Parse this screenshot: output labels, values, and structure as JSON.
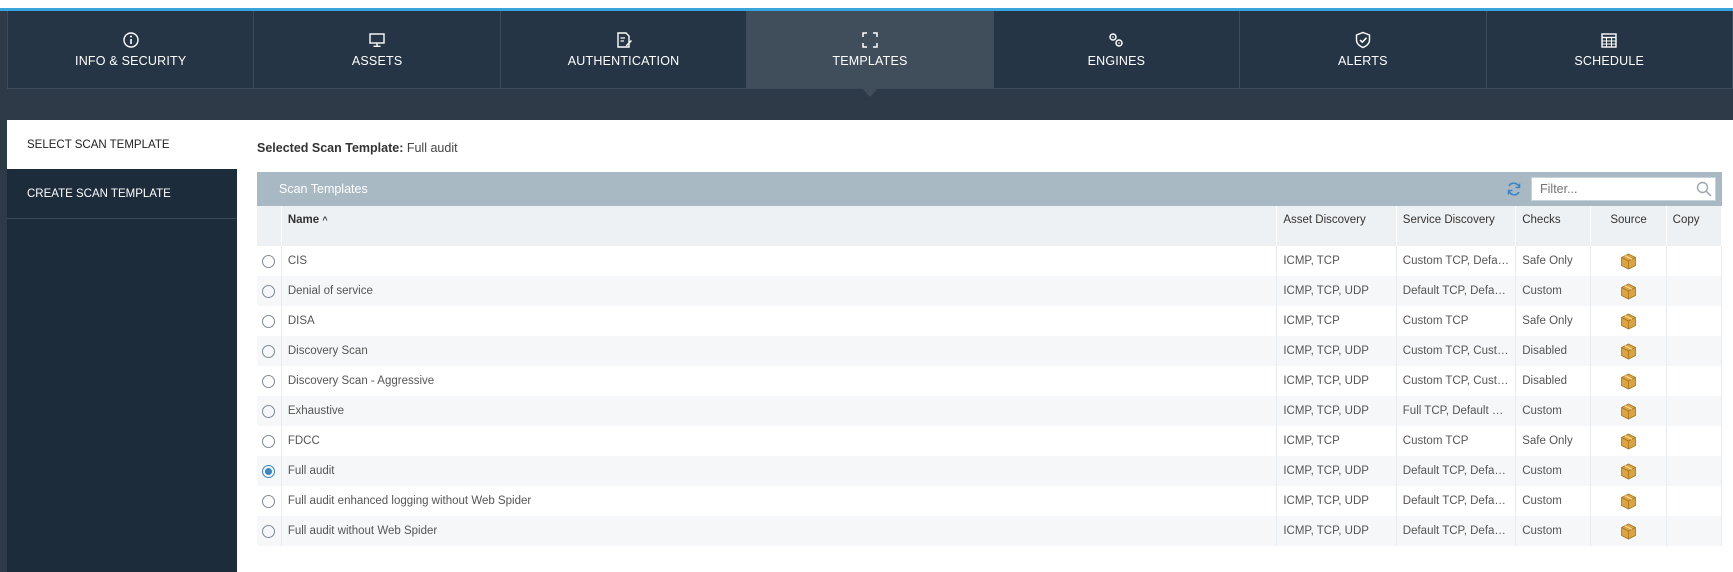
{
  "tabs": [
    {
      "label": "INFO & SECURITY",
      "icon": "info-icon"
    },
    {
      "label": "ASSETS",
      "icon": "monitor-icon"
    },
    {
      "label": "AUTHENTICATION",
      "icon": "edit-document-icon"
    },
    {
      "label": "TEMPLATES",
      "icon": "frame-icon",
      "active": true
    },
    {
      "label": "ENGINES",
      "icon": "gears-icon"
    },
    {
      "label": "ALERTS",
      "icon": "shield-check-icon"
    },
    {
      "label": "SCHEDULE",
      "icon": "calendar-icon"
    }
  ],
  "sidebar": {
    "items": [
      {
        "label": "SELECT SCAN TEMPLATE",
        "active": true
      },
      {
        "label": "CREATE SCAN TEMPLATE",
        "active": false
      }
    ]
  },
  "main": {
    "selected_prefix": "Selected Scan Template:",
    "selected_value": "Full audit",
    "panel_title": "Scan Templates",
    "filter_placeholder": "Filter..."
  },
  "table": {
    "columns": [
      "Name",
      "Asset Discovery",
      "Service Discovery",
      "Checks",
      "Source",
      "Copy"
    ],
    "sort_indicator": "^",
    "rows": [
      {
        "name": "CIS",
        "asset": "ICMP, TCP",
        "service": "Custom TCP, Default UDP",
        "checks": "Safe Only",
        "selected": false
      },
      {
        "name": "Denial of service",
        "asset": "ICMP, TCP, UDP",
        "service": "Default TCP, Default UDP",
        "checks": "Custom",
        "selected": false
      },
      {
        "name": "DISA",
        "asset": "ICMP, TCP",
        "service": "Custom TCP",
        "checks": "Safe Only",
        "selected": false
      },
      {
        "name": "Discovery Scan",
        "asset": "ICMP, TCP, UDP",
        "service": "Custom TCP, Custom UDP",
        "checks": "Disabled",
        "selected": false
      },
      {
        "name": "Discovery Scan - Aggressive",
        "asset": "ICMP, TCP, UDP",
        "service": "Custom TCP, Custom UDP",
        "checks": "Disabled",
        "selected": false
      },
      {
        "name": "Exhaustive",
        "asset": "ICMP, TCP, UDP",
        "service": "Full TCP, Default UDP",
        "checks": "Custom",
        "selected": false
      },
      {
        "name": "FDCC",
        "asset": "ICMP, TCP",
        "service": "Custom TCP",
        "checks": "Safe Only",
        "selected": false
      },
      {
        "name": "Full audit",
        "asset": "ICMP, TCP, UDP",
        "service": "Default TCP, Default UDP",
        "checks": "Custom",
        "selected": true
      },
      {
        "name": "Full audit enhanced logging without Web Spider",
        "asset": "ICMP, TCP, UDP",
        "service": "Default TCP, Default UDP",
        "checks": "Custom",
        "selected": false
      },
      {
        "name": "Full audit without Web Spider",
        "asset": "ICMP, TCP, UDP",
        "service": "Default TCP, Default UDP",
        "checks": "Custom",
        "selected": false
      }
    ]
  },
  "colors": {
    "accent": "#3aa5dc",
    "tab_bg": "#253545",
    "tab_active_bg": "#404d5a",
    "panel_header": "#a9b9c4",
    "radio_selected": "#3a86c8"
  }
}
